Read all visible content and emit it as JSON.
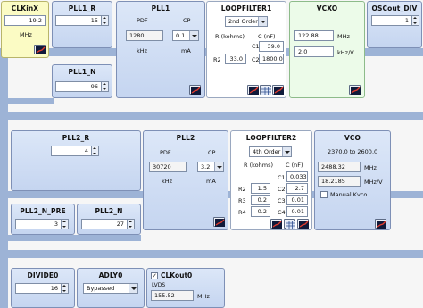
{
  "clkinx": {
    "title": "CLKinX",
    "value": "19.2",
    "unit": "MHz"
  },
  "pll1_r": {
    "title": "PLL1_R",
    "value": "15"
  },
  "pll1": {
    "title": "PLL1",
    "pdf_label": "PDF",
    "cp_label": "CP",
    "pdf_value": "1280",
    "cp_value": "0.1",
    "pdf_unit": "kHz",
    "cp_unit": "mA"
  },
  "loopfilter1": {
    "title": "LOOPFILTER1",
    "order": "2nd Order",
    "r_header": "R (kohms)",
    "c_header": "C (nF)",
    "c1_label": "C1",
    "c1_value": "39.0",
    "r2_label": "R2",
    "r2_value": "33.0",
    "c2_label": "C2",
    "c2_value": "1800.0"
  },
  "vcxo": {
    "title": "VCXO",
    "freq": "122.88",
    "freq_unit": "MHz",
    "gain": "2.0",
    "gain_unit": "kHz/V"
  },
  "oscout_div": {
    "title": "OSCout_DIV",
    "value": "1"
  },
  "pll1_n": {
    "title": "PLL1_N",
    "value": "96"
  },
  "pll2_r": {
    "title": "PLL2_R",
    "value": "4"
  },
  "pll2": {
    "title": "PLL2",
    "pdf_label": "PDF",
    "cp_label": "CP",
    "pdf_value": "30720",
    "cp_value": "3.2",
    "pdf_unit": "kHz",
    "cp_unit": "mA"
  },
  "loopfilter2": {
    "title": "LOOPFILTER2",
    "order": "4th Order",
    "r_header": "R (kohms)",
    "c_header": "C (nF)",
    "c1_label": "C1",
    "c1_value": "0.033",
    "r2_label": "R2",
    "r2_value": "1.5",
    "c2_label": "C2",
    "c2_value": "2.7",
    "r3_label": "R3",
    "r3_value": "0.2",
    "c3_label": "C3",
    "c3_value": "0.01",
    "r4_label": "R4",
    "r4_value": "0.2",
    "c4_label": "C4",
    "c4_value": "0.01"
  },
  "vco": {
    "title": "VCO",
    "range": "2370.0 to 2600.0",
    "freq": "2488.32",
    "freq_unit": "MHz",
    "gain": "18.2185",
    "gain_unit": "MHz/V",
    "manual_kvco_label": "Manual Kvco"
  },
  "pll2_n_pre": {
    "title": "PLL2_N_PRE",
    "value": "3"
  },
  "pll2_n": {
    "title": "PLL2_N",
    "value": "27"
  },
  "divide0": {
    "title": "DIVIDE0",
    "value": "16"
  },
  "adly0": {
    "title": "ADLY0",
    "mode": "Bypassed"
  },
  "clkout0": {
    "title": "CLKout0",
    "checked": true,
    "check_mark": "✓",
    "format": "LVDS",
    "freq": "155.52",
    "unit": "MHz"
  },
  "colors": {
    "block_blue": "#c5d5f0",
    "bus": "#9db3d6",
    "clkinx_yellow": "#fbfbc4",
    "vcxo_green": "#ecfbe9"
  },
  "icons": {
    "loop_filter_buttons": [
      "scope-icon",
      "table-icon",
      "scope-icon"
    ],
    "plot_button": "scope-icon"
  }
}
